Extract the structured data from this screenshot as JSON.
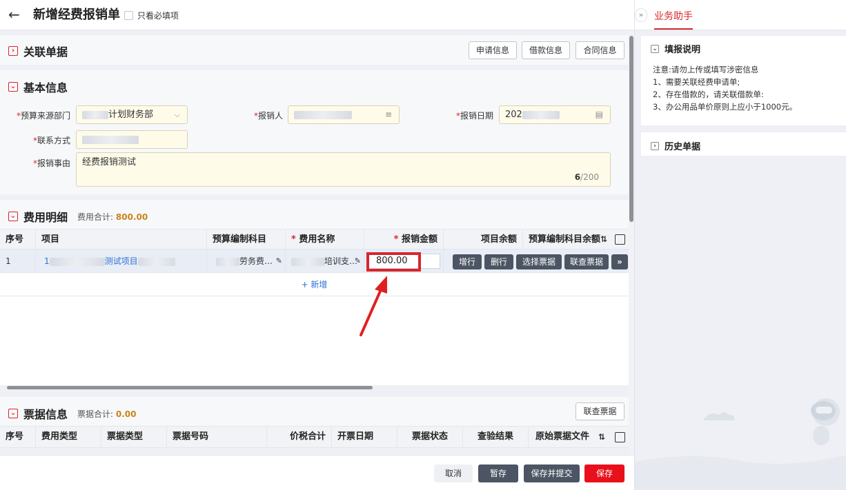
{
  "header": {
    "title": "新增经费报销单",
    "only_required_label": "只看必填项"
  },
  "related": {
    "title": "关联单据",
    "buttons": [
      "申请信息",
      "借款信息",
      "合同信息"
    ]
  },
  "basic": {
    "title": "基本信息",
    "dept_label": "预算来源部门",
    "dept_value": "计划财务部",
    "claimant_label": "报销人",
    "date_label": "报销日期",
    "date_value": "202",
    "contact_label": "联系方式",
    "reason_label": "报销事由",
    "reason_value": "经费报销测试",
    "reason_count": "6",
    "reason_max": "/200"
  },
  "expense": {
    "title": "费用明细",
    "total_label": "费用合计:",
    "total_value": "800.00",
    "columns": [
      "序号",
      "项目",
      "预算编制科目",
      "费用名称",
      "报销金额",
      "项目余额",
      "预算编制科目余额"
    ],
    "row": {
      "index": "1",
      "project_prefix": "1",
      "project": "测试项目",
      "subject": "劳务费…",
      "fee_name": "培训支…",
      "amount": "800.00"
    },
    "row_actions": [
      "增行",
      "删行",
      "选择票据",
      "联查票据"
    ],
    "add_label": "+ 新增"
  },
  "invoice": {
    "title": "票据信息",
    "total_label": "票据合计:",
    "total_value": "0.00",
    "query_button": "联查票据",
    "columns": [
      "序号",
      "费用类型",
      "票据类型",
      "票据号码",
      "价税合计",
      "开票日期",
      "票据状态",
      "查验结果",
      "原始票据文件"
    ]
  },
  "footer": {
    "cancel": "取消",
    "draft": "暂存",
    "save_submit": "保存并提交",
    "save": "保存"
  },
  "assistant": {
    "tab": "业务助手",
    "guide_title": "填报说明",
    "guide_lines": [
      "注意:请勿上传或填写涉密信息",
      "1、需要关联经费申请单;",
      "2、存在借款的，请关联借款单:",
      "3、办公用品单价原则上应小于1000元。"
    ],
    "history_title": "历史单据"
  },
  "colors": {
    "accent_red": "#d7262c",
    "dark_button": "#4b5563",
    "input_fill": "#fefbe9"
  }
}
